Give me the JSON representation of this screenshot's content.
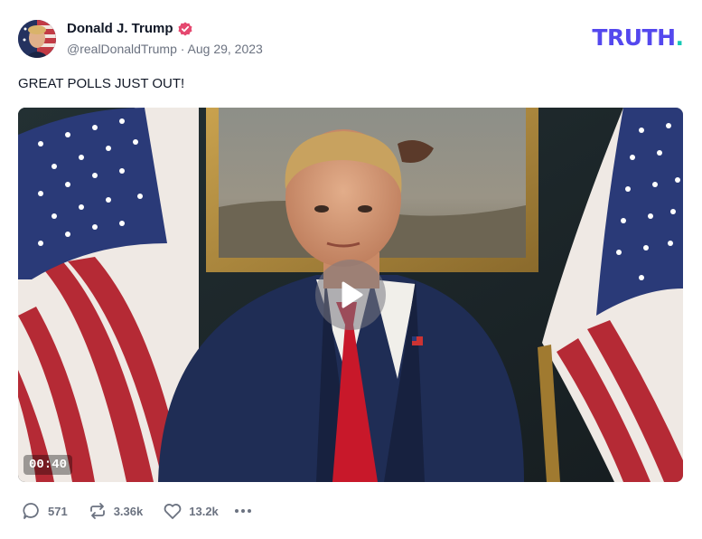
{
  "post": {
    "author_name": "Donald J. Trump",
    "handle_date": "@realDonaldTrump · Aug 29, 2023",
    "text": "GREAT POLLS JUST OUT!",
    "brand": "TRUTH",
    "brand_dot": "."
  },
  "video": {
    "duration": "00:40",
    "play_icon": "play-icon"
  },
  "actions": {
    "replies": "571",
    "retruths": "3.36k",
    "likes": "13.2k"
  },
  "colors": {
    "brand": "#5448ee",
    "brand_dot": "#16c9b5",
    "verified": "#e5486f",
    "muted": "#6b7280"
  },
  "icons": [
    "verified-badge-icon",
    "reply-icon",
    "retruth-icon",
    "heart-icon",
    "more-icon"
  ]
}
